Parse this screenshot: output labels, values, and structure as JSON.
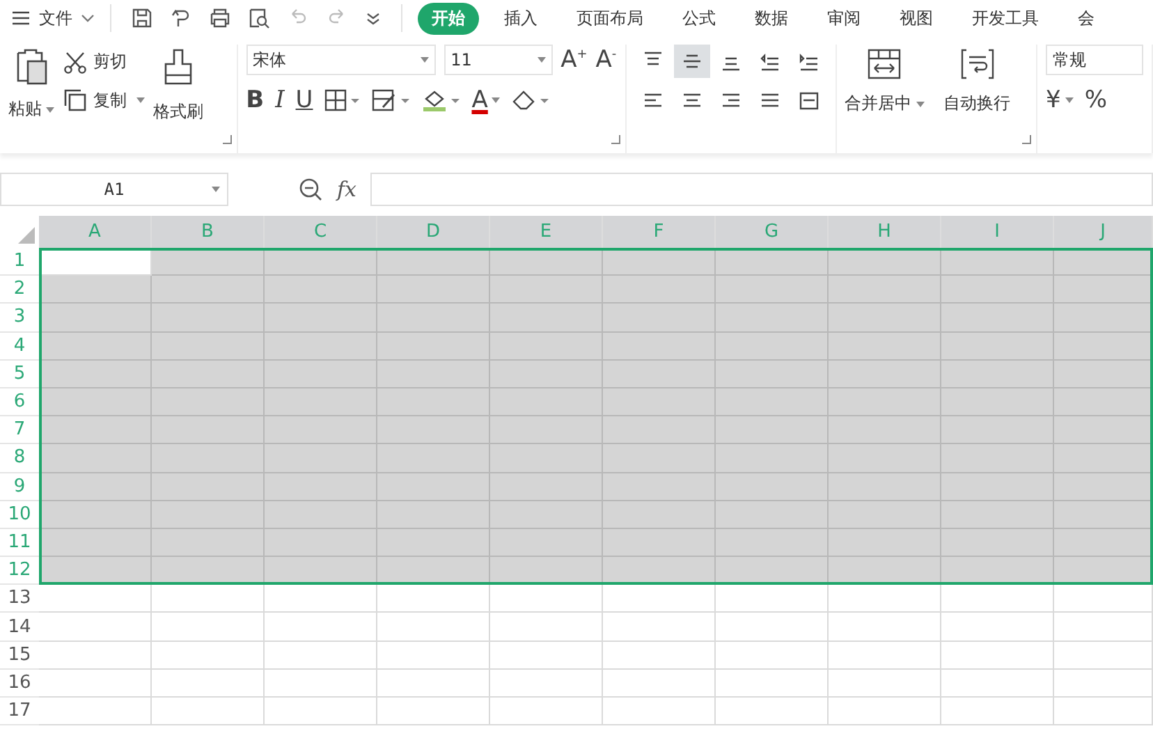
{
  "menu": {
    "label": "文件"
  },
  "tabs": [
    {
      "label": "开始",
      "selected": true
    },
    {
      "label": "插入",
      "selected": false
    },
    {
      "label": "页面布局",
      "selected": false
    },
    {
      "label": "公式",
      "selected": false
    },
    {
      "label": "数据",
      "selected": false
    },
    {
      "label": "审阅",
      "selected": false
    },
    {
      "label": "视图",
      "selected": false
    },
    {
      "label": "开发工具",
      "selected": false
    },
    {
      "label": "会",
      "selected": false
    }
  ],
  "clipboard": {
    "paste": "粘贴",
    "cut": "剪切",
    "copy": "复制",
    "format_painter": "格式刷"
  },
  "font": {
    "name": "宋体",
    "size": "11",
    "grow": "A",
    "grow_sign": "+",
    "shrink": "A",
    "shrink_sign": "-",
    "bold": "B",
    "italic": "I",
    "underline": "U",
    "font_color": "A"
  },
  "align_buttons": [
    {
      "selected": false
    },
    {
      "selected": true
    },
    {
      "selected": false
    },
    {
      "selected": false
    },
    {
      "selected": false
    },
    {
      "selected": false
    },
    {
      "selected": false
    },
    {
      "selected": false
    },
    {
      "selected": false
    },
    {
      "selected": false
    }
  ],
  "merge": {
    "label": "合并居中"
  },
  "wrap": {
    "label": "自动换行"
  },
  "number": {
    "format": "常规",
    "currency": "¥",
    "percent": "%"
  },
  "name_box": {
    "value": "A1"
  },
  "formula_bar": {
    "fx": "fx"
  },
  "grid": {
    "columns": [
      {
        "label": "A",
        "selected": true,
        "active": true
      },
      {
        "label": "B",
        "selected": true,
        "active": false
      },
      {
        "label": "C",
        "selected": true,
        "active": false
      },
      {
        "label": "D",
        "selected": true,
        "active": false
      },
      {
        "label": "E",
        "selected": true,
        "active": false
      },
      {
        "label": "F",
        "selected": true,
        "active": false
      },
      {
        "label": "G",
        "selected": true,
        "active": false
      },
      {
        "label": "H",
        "selected": true,
        "active": false
      },
      {
        "label": "I",
        "selected": true,
        "active": false
      },
      {
        "label": "J",
        "selected": true,
        "active": false
      }
    ],
    "rows": [
      {
        "label": "1",
        "selected": true,
        "active": true
      },
      {
        "label": "2",
        "selected": true,
        "active": false
      },
      {
        "label": "3",
        "selected": true,
        "active": false
      },
      {
        "label": "4",
        "selected": true,
        "active": false
      },
      {
        "label": "5",
        "selected": true,
        "active": false
      },
      {
        "label": "6",
        "selected": true,
        "active": false
      },
      {
        "label": "7",
        "selected": true,
        "active": false
      },
      {
        "label": "8",
        "selected": true,
        "active": false
      },
      {
        "label": "9",
        "selected": true,
        "active": false
      },
      {
        "label": "10",
        "selected": true,
        "active": false
      },
      {
        "label": "11",
        "selected": true,
        "active": false
      },
      {
        "label": "12",
        "selected": true,
        "active": false
      },
      {
        "label": "13",
        "selected": false,
        "active": false
      },
      {
        "label": "14",
        "selected": false,
        "active": false
      },
      {
        "label": "15",
        "selected": false,
        "active": false
      },
      {
        "label": "16",
        "selected": false,
        "active": false
      },
      {
        "label": "17",
        "selected": false,
        "active": false
      }
    ]
  }
}
